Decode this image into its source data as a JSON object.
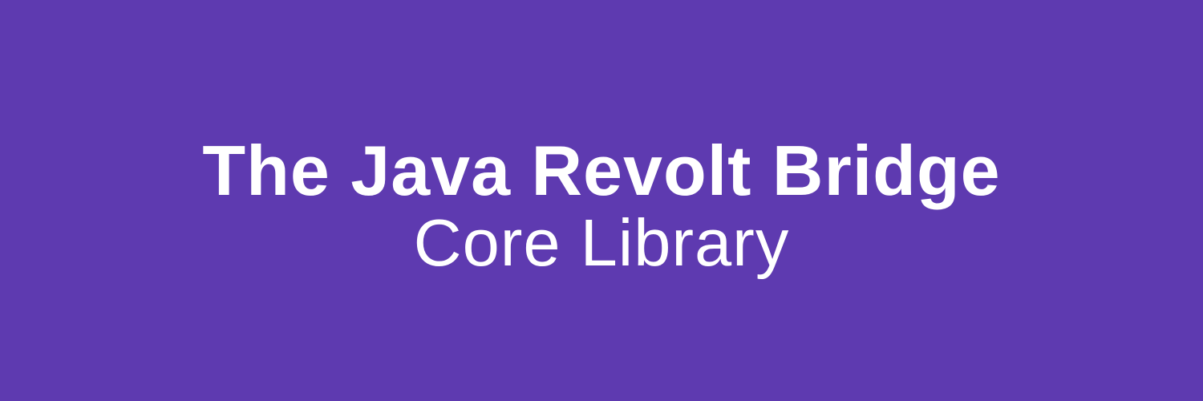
{
  "banner": {
    "title": "The Java Revolt Bridge",
    "subtitle": "Core Library",
    "background_color": "#5e3ab0",
    "text_color": "#ffffff"
  }
}
